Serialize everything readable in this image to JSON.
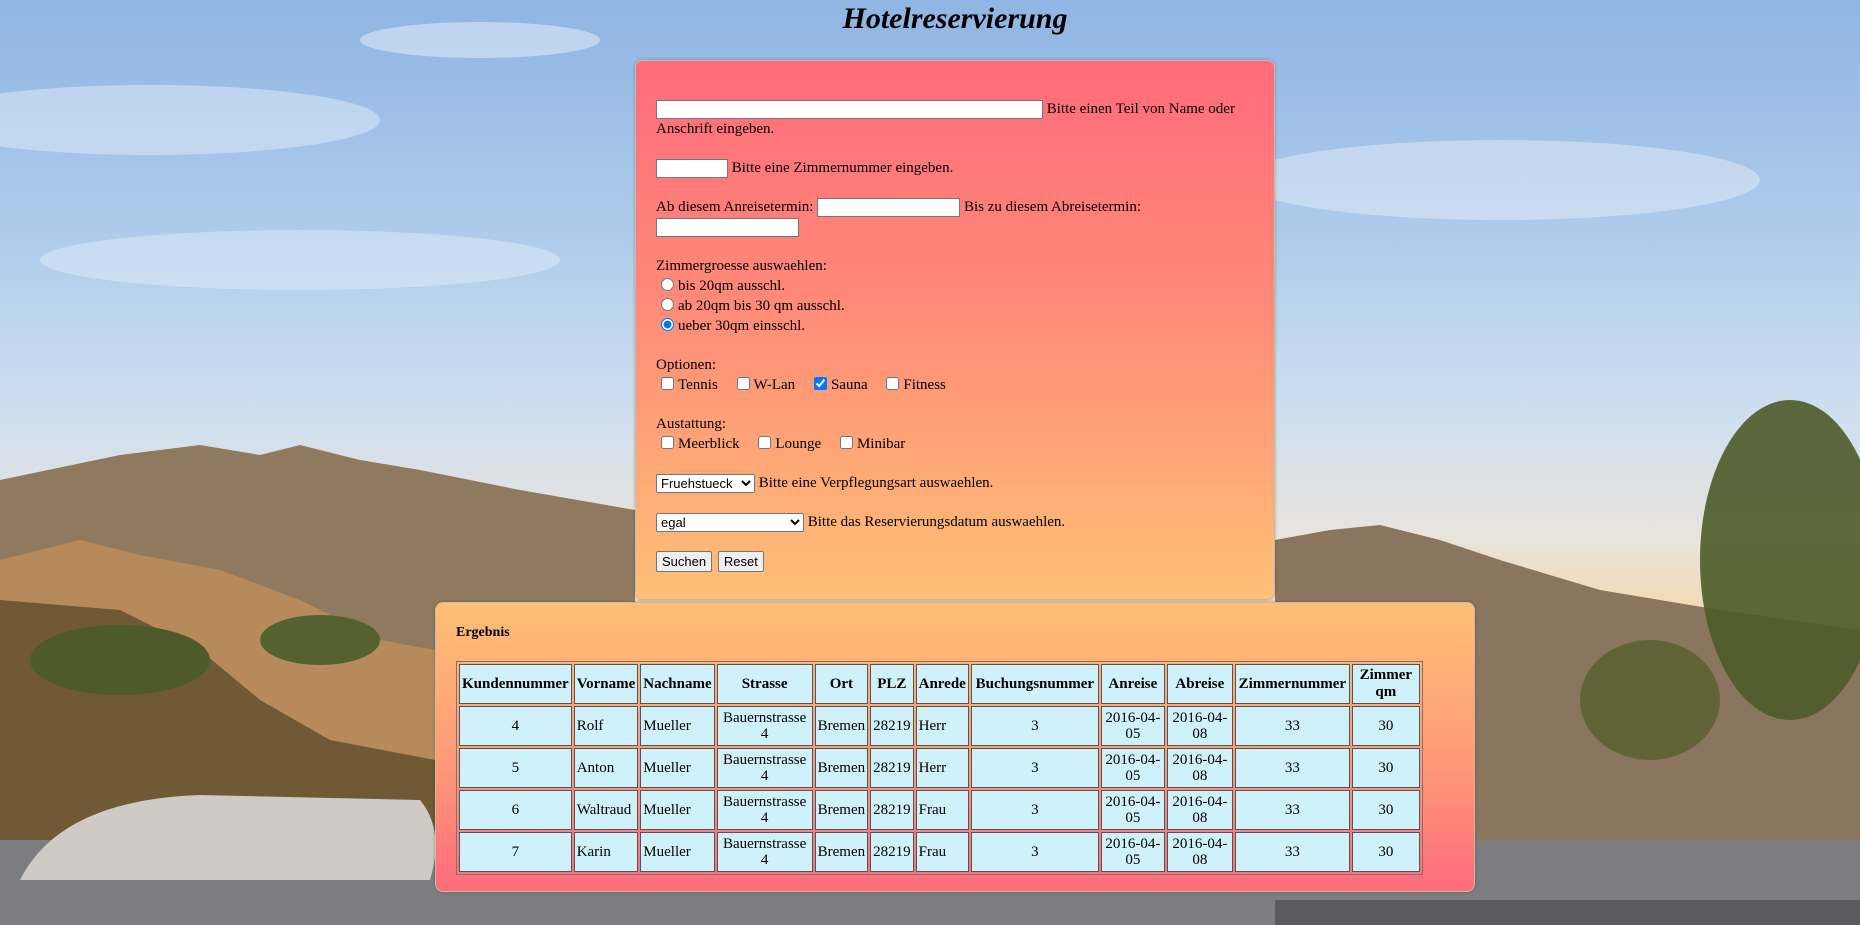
{
  "page": {
    "title": "Hotelreservierung"
  },
  "form": {
    "search_hint": "Bitte einen Teil von Name oder Anschrift eingeben.",
    "search_value": "",
    "room_hint": "Bitte eine Zimmernummer eingeben.",
    "room_value": "",
    "arrival_label": "Ab diesem Anreisetermin:",
    "arrival_value": "",
    "departure_label": "Bis zu diesem Abreisetermin:",
    "departure_value": "",
    "size_label": "Zimmergroesse auswaehlen:",
    "sizes": [
      {
        "label": "bis 20qm ausschl.",
        "checked": false
      },
      {
        "label": "ab 20qm bis 30 qm ausschl.",
        "checked": false
      },
      {
        "label": "ueber 30qm einsschl.",
        "checked": true
      }
    ],
    "options_label": "Optionen:",
    "options": [
      {
        "label": "Tennis",
        "checked": false
      },
      {
        "label": "W-Lan",
        "checked": false
      },
      {
        "label": "Sauna",
        "checked": true
      },
      {
        "label": "Fitness",
        "checked": false
      }
    ],
    "equipment_label": "Austattung:",
    "equipment": [
      {
        "label": "Meerblick",
        "checked": false
      },
      {
        "label": "Lounge",
        "checked": false
      },
      {
        "label": "Minibar",
        "checked": false
      }
    ],
    "meal_selected": "Fruehstueck",
    "meal_hint": "Bitte eine Verpflegungsart auswaehlen.",
    "date_selected": "egal",
    "date_hint": "Bitte das Reservierungsdatum auswaehlen.",
    "search_button": "Suchen",
    "reset_button": "Reset"
  },
  "result": {
    "title": "Ergebnis",
    "columns": [
      "Kundennummer",
      "Vorname",
      "Nachname",
      "Strasse",
      "Ort",
      "PLZ",
      "Anrede",
      "Buchungsnummer",
      "Anreise",
      "Abreise",
      "Zimmernummer",
      "Zimmer qm"
    ],
    "rows": [
      [
        "4",
        "Rolf",
        "Mueller",
        "Bauernstrasse 4",
        "Bremen",
        "28219",
        "Herr",
        "3",
        "2016-04-05",
        "2016-04-08",
        "33",
        "30"
      ],
      [
        "5",
        "Anton",
        "Mueller",
        "Bauernstrasse 4",
        "Bremen",
        "28219",
        "Herr",
        "3",
        "2016-04-05",
        "2016-04-08",
        "33",
        "30"
      ],
      [
        "6",
        "Waltraud",
        "Mueller",
        "Bauernstrasse 4",
        "Bremen",
        "28219",
        "Frau",
        "3",
        "2016-04-05",
        "2016-04-08",
        "33",
        "30"
      ],
      [
        "7",
        "Karin",
        "Mueller",
        "Bauernstrasse 4",
        "Bremen",
        "28219",
        "Frau",
        "3",
        "2016-04-05",
        "2016-04-08",
        "33",
        "30"
      ]
    ]
  }
}
